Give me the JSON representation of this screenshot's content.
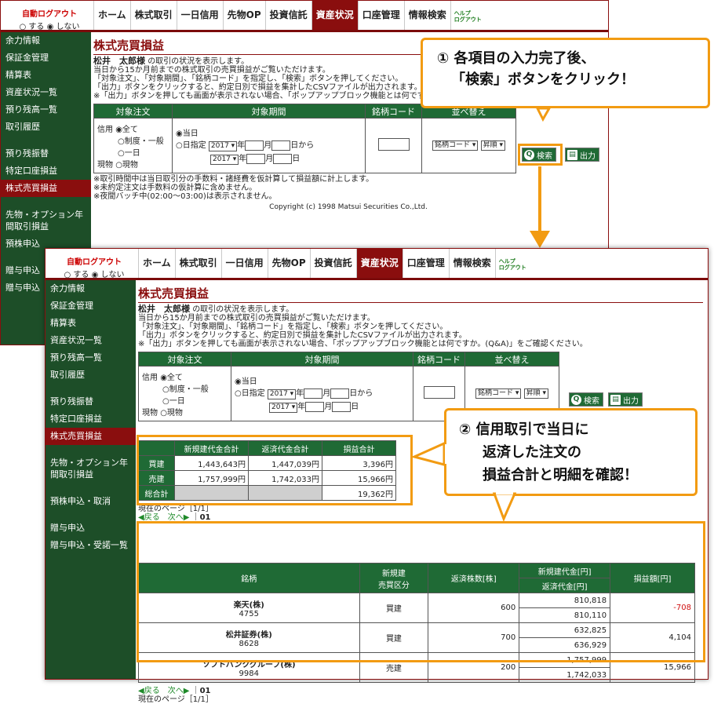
{
  "nav": {
    "autologout": "自動ログアウト",
    "opt_on": "○ する",
    "opt_off": "◉ しない",
    "tabs": [
      "ホーム",
      "株式取引",
      "一日信用",
      "先物OP",
      "投資信託",
      "資産状況",
      "口座管理",
      "情報検索"
    ],
    "help": "ヘルプ",
    "logout": "ログアウト"
  },
  "side": [
    "余力情報",
    "保証金管理",
    "精算表",
    "資産状況一覧",
    "預り残高一覧",
    "取引履歴",
    "預り残振替",
    "特定口座損益",
    "株式売買損益",
    "先物・オプション年間取引損益",
    "預株申込・取消",
    "贈与申込",
    "贈与申込・受諾一覧"
  ],
  "side1": [
    "余力情報",
    "保証金管理",
    "精算表",
    "資産状況一覧",
    "預り残高一覧",
    "取引履歴",
    "預り残振替",
    "特定口座損益",
    "株式売買損益",
    "先物・オプション年間取引損益",
    "預株申込",
    "贈与申込",
    "贈与申込"
  ],
  "page": {
    "title": "株式売買損益",
    "user": "松井　太郎様",
    "user_suffix": "の取引の状況を表示します。",
    "desc": [
      "当日から15か月前までの株式取引の売買損益がご覧いただけます。",
      "「対象注文」、「対象期間」、「銘柄コード」を指定し、「検索」ボタンを押してください。",
      "「出力」ボタンをクリックすると、約定日別で損益を集計したCSVファイルが出力されます。",
      "※「出力」ボタンを押しても画面が表示されない場合、「ポップアップブロック機能とは何ですか。(Q&A)」をご確認ください。"
    ]
  },
  "form": {
    "h_order": "対象注文",
    "h_period": "対象期間",
    "h_code": "銘柄コード",
    "h_sort": "並べ替え",
    "credit": "信用",
    "cash": "現物",
    "o_all": "◉全て",
    "o_seido": "○制度・一般",
    "o_ichi": "○一日",
    "o_genbutsu": "○現物",
    "p_today": "◉当日",
    "p_date": "○日指定",
    "year": "2017 ▾",
    "nen": "年",
    "tsuki": "月",
    "hi_kara": "日から",
    "hi": "日",
    "sort_key": "銘柄コード ▾",
    "sort_dir": "昇順 ▾",
    "search": "検索",
    "output": "出力"
  },
  "notes": [
    "※取引時間中は当日取引分の手数料・諸経費を仮計算して損益額に計上します。",
    "※未約定注文は手数料の仮計算に含めません。",
    "※夜間バッチ中(02:00〜03:00)は表示されません。"
  ],
  "copyright": "Copyright (c) 1998 Matsui Securities Co.,Ltd.",
  "callout1": {
    "line1": "① 各項目の入力完了後、",
    "line2": "「検索」ボタンをクリック！"
  },
  "callout2": {
    "line1": "② 信用取引で当日に",
    "line2": "返済した注文の",
    "line3": "損益合計と明細を確認！"
  },
  "summary": {
    "headers": [
      "新規建代金合計",
      "返済代金合計",
      "損益合計"
    ],
    "rows": [
      {
        "label": "買建",
        "v1": "1,443,643円",
        "v2": "1,447,039円",
        "v3": "3,396円"
      },
      {
        "label": "売建",
        "v1": "1,757,999円",
        "v2": "1,742,033円",
        "v3": "15,966円"
      },
      {
        "label": "総合計",
        "v1": "",
        "v2": "",
        "v3": "19,362円"
      }
    ]
  },
  "pager": {
    "current": "現在のページ［1/1］",
    "prev": "◀戻る",
    "next": "次へ▶",
    "sep": "｜",
    "num": "01"
  },
  "detail": {
    "h_name": "銘柄",
    "h_type1": "新規建",
    "h_type2": "売買区分",
    "h_qty": "返済株数[株]",
    "h_open": "新規建代金[円]",
    "h_close": "返済代金[円]",
    "h_pl": "損益額[円]",
    "rows": [
      {
        "name": "楽天(株)",
        "code": "4755",
        "type": "買建",
        "qty": "600",
        "open": "810,818",
        "close": "810,110",
        "pl": "-708",
        "neg": true
      },
      {
        "name": "松井証券(株)",
        "code": "8628",
        "type": "買建",
        "qty": "700",
        "open": "632,825",
        "close": "636,929",
        "pl": "4,104",
        "neg": false
      },
      {
        "name": "ソフトバンクグループ(株)",
        "code": "9984",
        "type": "売建",
        "qty": "200",
        "open": "1,757,999",
        "close": "1,742,033",
        "pl": "15,966",
        "neg": false
      }
    ]
  },
  "colors": {
    "accent": "#8a0e0e",
    "green": "#1f6a35",
    "orange": "#f29b12"
  }
}
